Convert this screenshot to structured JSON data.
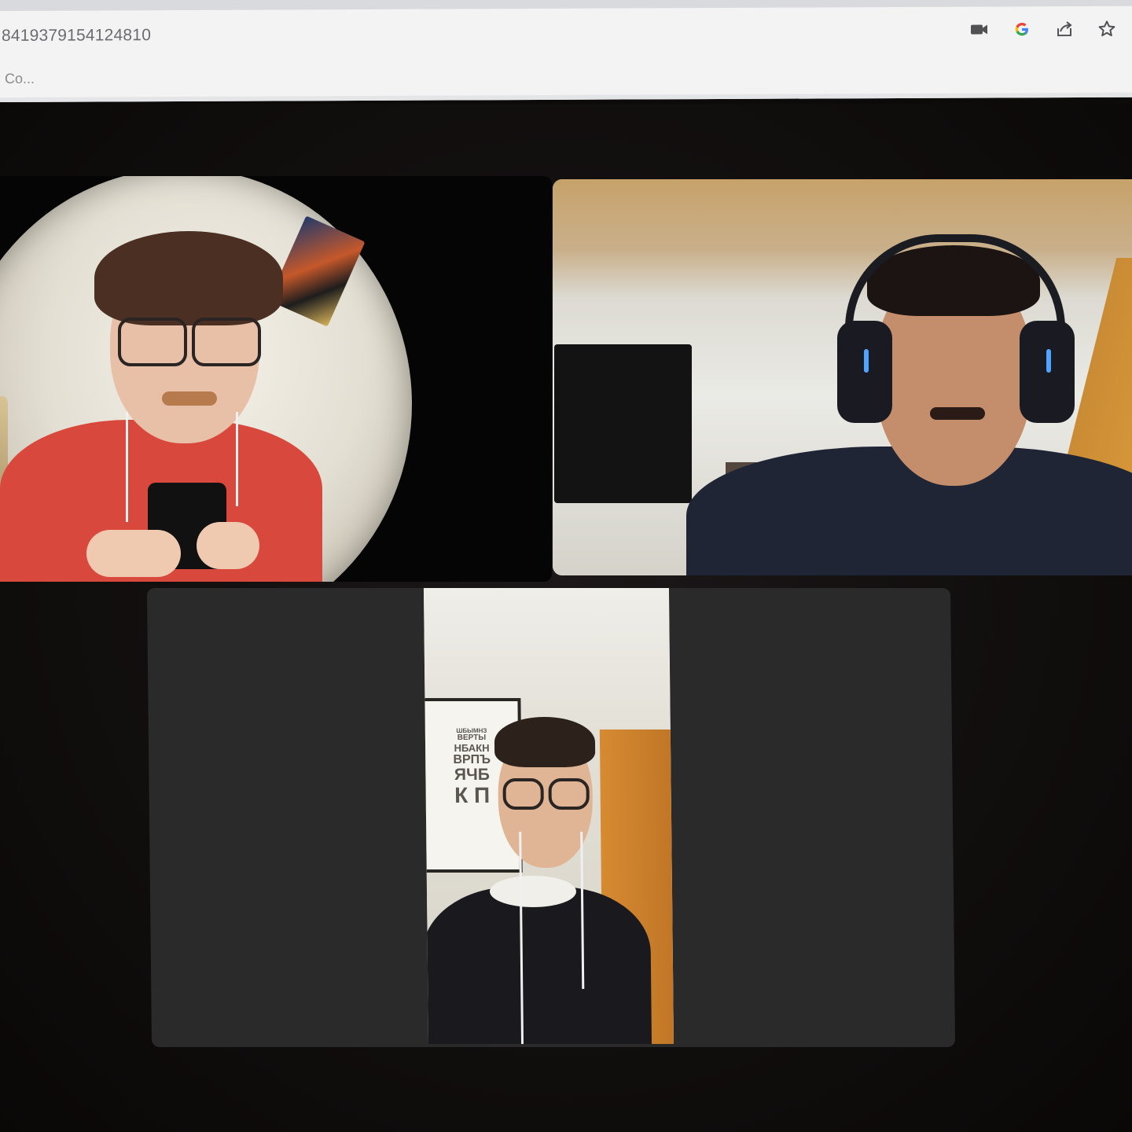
{
  "browser": {
    "url_fragment": "8419379154124810",
    "bookmark_label": "Co...",
    "icons": [
      "camera-icon",
      "google-lens-icon",
      "share-icon",
      "bookmark-star-icon"
    ]
  },
  "meeting": {
    "participant_tiles": 3,
    "eye_chart_rows": [
      "ШБЫМНЗ",
      "ВЕРТЫ",
      "НБАКН",
      "ВРПЪ",
      "ЯЧБ",
      "К П"
    ]
  },
  "colors": {
    "stage_background": "#0d0a0a",
    "tile_placeholder": "#2b2a2a",
    "chrome_background": "#f3f3f4",
    "url_text": "#6c6c70"
  }
}
